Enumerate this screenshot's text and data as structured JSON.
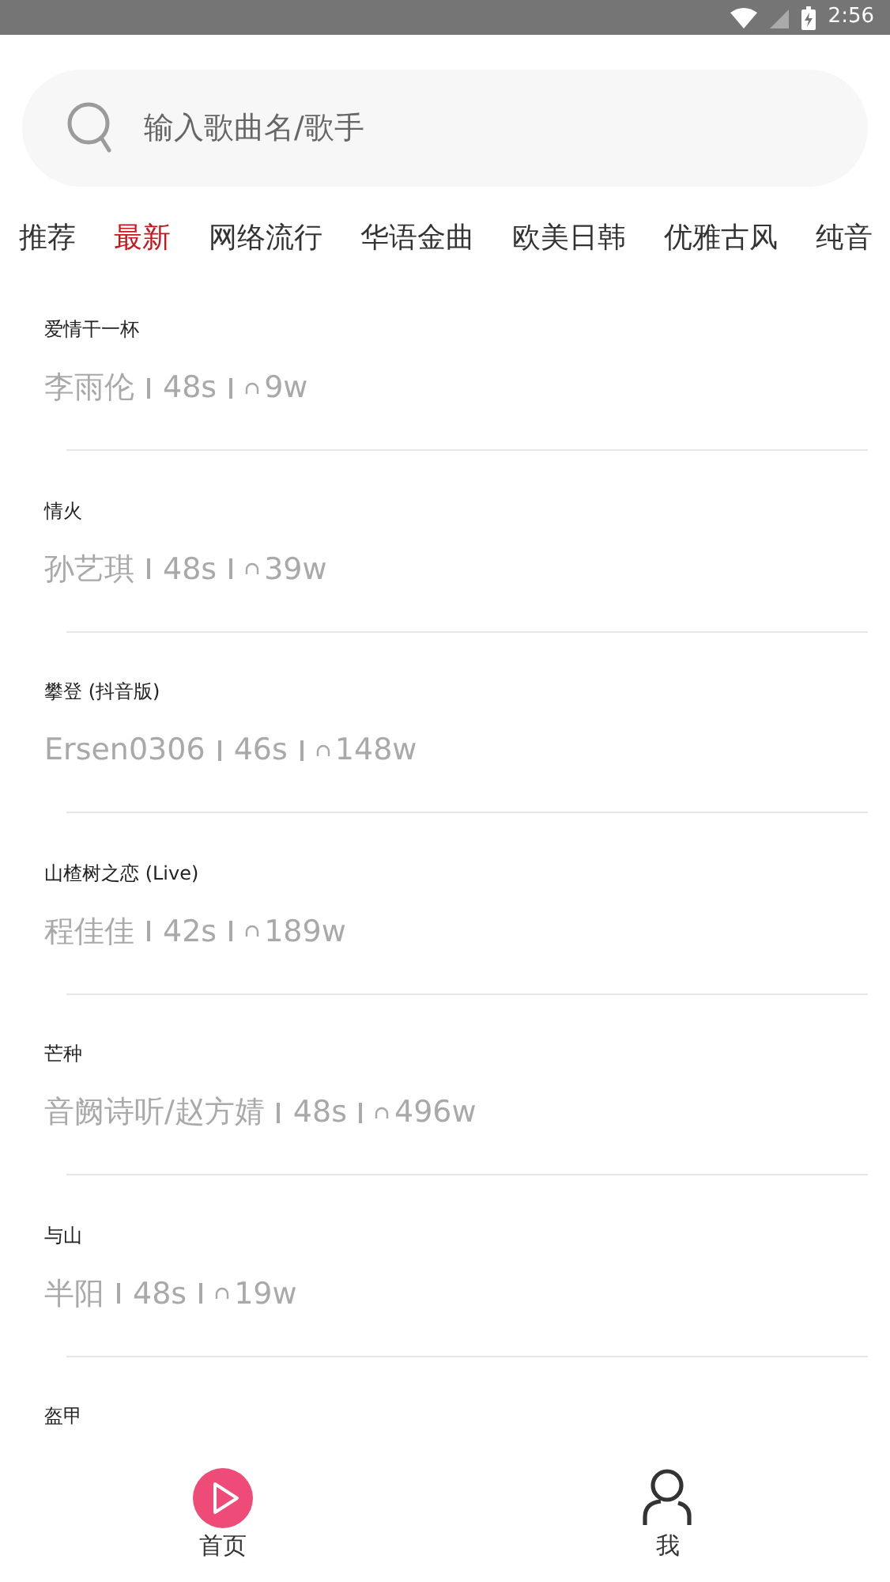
{
  "status_bar": {
    "time": "2:56"
  },
  "search": {
    "placeholder": "输入歌曲名/歌手"
  },
  "tabs": [
    {
      "label": "推荐",
      "selected": false
    },
    {
      "label": "最新",
      "selected": true
    },
    {
      "label": "网络流行",
      "selected": false
    },
    {
      "label": "华语金曲",
      "selected": false
    },
    {
      "label": "欧美日韩",
      "selected": false
    },
    {
      "label": "优雅古风",
      "selected": false
    },
    {
      "label": "纯音",
      "selected": false
    }
  ],
  "songs": [
    {
      "title": "爱情干一杯",
      "artist": "李雨伦",
      "duration": "48s",
      "plays": "9w"
    },
    {
      "title": "情火",
      "artist": "孙艺琪",
      "duration": "48s",
      "plays": "39w"
    },
    {
      "title": "攀登 (抖音版)",
      "artist": "Ersen0306",
      "duration": "46s",
      "plays": "148w"
    },
    {
      "title": "山楂树之恋 (Live)",
      "artist": "程佳佳",
      "duration": "42s",
      "plays": "189w"
    },
    {
      "title": "芒种",
      "artist": "音阙诗听/赵方婧",
      "duration": "48s",
      "plays": "496w"
    },
    {
      "title": "与山",
      "artist": "半阳",
      "duration": "48s",
      "plays": "19w"
    },
    {
      "title": "盔甲"
    }
  ],
  "bottom_nav": [
    {
      "label": "首页",
      "selected": true,
      "kind": "play"
    },
    {
      "label": "我",
      "selected": false,
      "kind": "user"
    }
  ]
}
